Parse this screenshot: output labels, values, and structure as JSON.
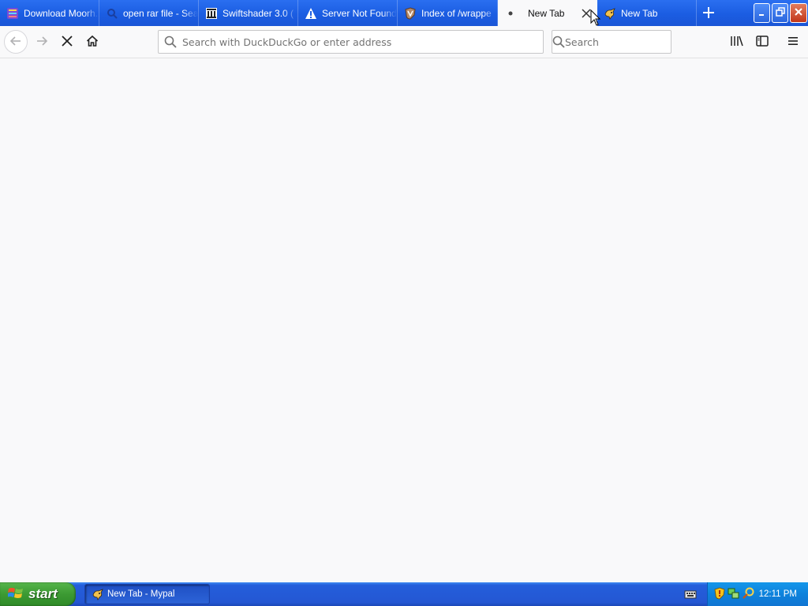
{
  "browser": {
    "tabs": [
      {
        "label": "Download Moorh...",
        "icon": "app-grid-icon",
        "active": false
      },
      {
        "label": "open rar file - Sea",
        "icon": "search-icon",
        "active": false
      },
      {
        "label": "Swiftshader 3.0 (",
        "icon": "bank-icon",
        "active": false
      },
      {
        "label": "Server Not Found",
        "icon": "warning-icon",
        "active": false
      },
      {
        "label": "Index of /wrappe",
        "icon": "shield-icon",
        "active": false
      },
      {
        "label": "New Tab",
        "icon": "loading-dot-icon",
        "active": true
      },
      {
        "label": "New Tab",
        "icon": "mypal-icon",
        "active": false
      }
    ],
    "nav": {
      "address_placeholder": "Search with DuckDuckGo or enter address",
      "address_value": "",
      "search_placeholder": "Search",
      "search_value": ""
    },
    "colors": {
      "tabstrip": "#1b5de2",
      "content_bg": "#f9f9fa"
    }
  },
  "taskbar": {
    "start_label": "start",
    "task_item_label": "New Tab - Mypal",
    "clock": "12:11 PM"
  }
}
